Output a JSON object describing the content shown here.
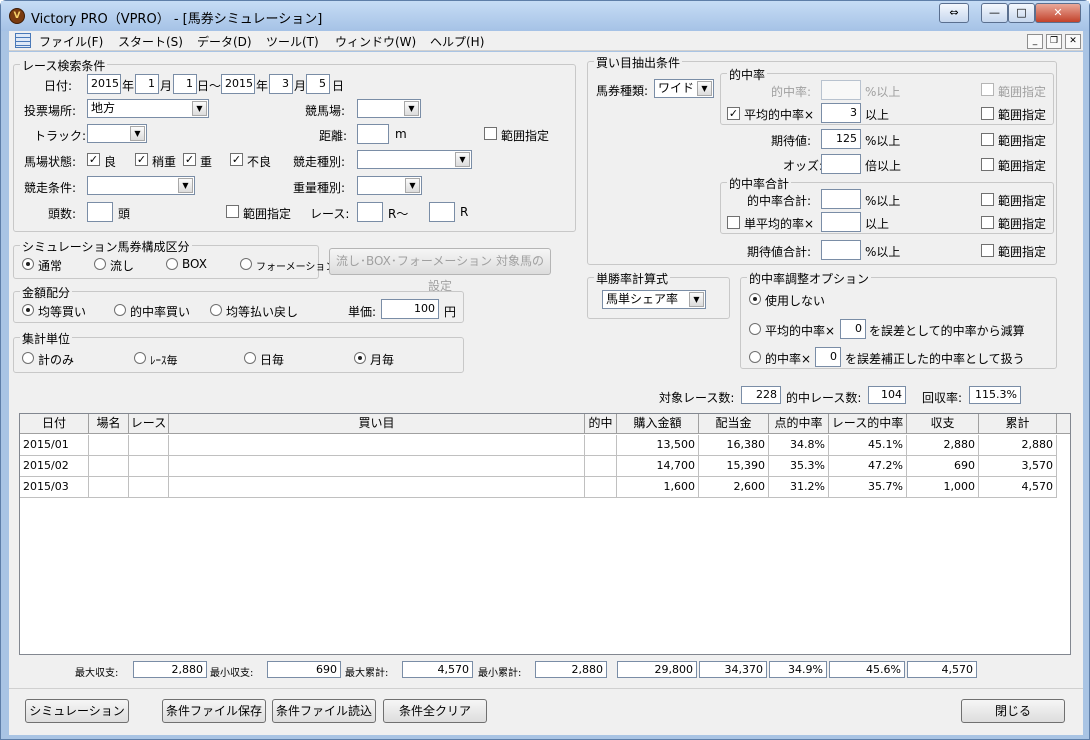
{
  "app": {
    "title": "Victory PRO（VPRO） - [馬券シミュレーション]",
    "icon": "victory-logo-icon"
  },
  "caption_buttons": {
    "back": "⇔",
    "minimize": "—",
    "maximize": "□",
    "close": "✕"
  },
  "menu": [
    "ファイル(F)",
    "スタート(S)",
    "データ(D)",
    "ツール(T)",
    "ウィンドウ(W)",
    "ヘルプ(H)"
  ],
  "mdi_buttons": {
    "minimize": "_",
    "restore": "❐",
    "close": "✕"
  },
  "race_search": {
    "legend": "レース検索条件",
    "date_label": "日付:",
    "from": {
      "year": "2015",
      "month": "1",
      "day": "1"
    },
    "to": {
      "year": "2015",
      "month": "3",
      "day": "5"
    },
    "u_year": "年",
    "u_month": "月",
    "u_day_from": "日～",
    "u_day": "日",
    "venue_place_label": "投票場所:",
    "venue_place_value": "地方",
    "track_label": "競馬場:",
    "track_value": "",
    "track_type_label": "トラック:",
    "track_type_value": "",
    "distance_label": "距離:",
    "distance_value": "",
    "distance_unit": "m",
    "range_label": "範囲指定",
    "condition_label": "馬場状態:",
    "conditions": [
      {
        "label": "良",
        "checked": true
      },
      {
        "label": "稍重",
        "checked": true
      },
      {
        "label": "重",
        "checked": true
      },
      {
        "label": "不良",
        "checked": true
      }
    ],
    "race_type_label": "競走種別:",
    "race_type_value": "",
    "race_cond_label": "競走条件:",
    "race_cond_value": "",
    "weight_label": "重量種別:",
    "weight_value": "",
    "heads_label": "頭数:",
    "heads_value": "",
    "heads_unit": "頭",
    "heads_range_label": "範囲指定",
    "race_label": "レース:",
    "race_from": "",
    "race_mid": "R～",
    "race_to": "",
    "race_unit": "R"
  },
  "sim_type": {
    "legend": "シミュレーション馬券構成区分",
    "options": [
      "通常",
      "流し",
      "BOX",
      "フォーメーション"
    ],
    "selected": 0,
    "setting_button": "流し･BOX･フォーメーション 対象馬の設定"
  },
  "amount": {
    "legend": "金額配分",
    "options": [
      "均等買い",
      "的中率買い",
      "均等払い戻し"
    ],
    "selected": 0,
    "unit_label": "単価:",
    "unit_value": "100",
    "unit": "円"
  },
  "aggregate": {
    "legend": "集計単位",
    "options": [
      "計のみ",
      "ﾚｰｽ毎",
      "日毎",
      "月毎"
    ],
    "selected": 3
  },
  "extract": {
    "legend": "買い目抽出条件",
    "ticket_label": "馬券種類:",
    "ticket_value": "ワイド",
    "hit_group": "的中率",
    "hit_rate_label": "的中率:",
    "hit_rate_value": "",
    "hit_rate_unit": "%以上",
    "avg_hit_label": "平均的中率×",
    "avg_hit_value": "3",
    "avg_hit_unit": "以上",
    "exp_label": "期待値:",
    "exp_value": "125",
    "exp_unit": "%以上",
    "odds_label": "オッズ:",
    "odds_value": "",
    "odds_unit": "倍以上",
    "total_group": "的中率合計",
    "total_hit_label": "的中率合計:",
    "total_hit_value": "",
    "total_hit_unit": "%以上",
    "single_avg_label": "単平均的率×",
    "single_avg_value": "",
    "single_avg_unit": "以上",
    "exp_total_label": "期待値合計:",
    "exp_total_value": "",
    "exp_total_unit": "%以上",
    "range_label": "範囲指定"
  },
  "win_calc": {
    "legend": "単勝率計算式",
    "value": "馬単シェア率"
  },
  "adjust": {
    "legend": "的中率調整オプション",
    "opt0": "使用しない",
    "opt1_pre": "平均的中率×",
    "opt1_val": "0",
    "opt1_post": "を誤差として的中率から減算",
    "opt2_pre": "的中率×",
    "opt2_val": "0",
    "opt2_post": "を誤差補正した的中率として扱う",
    "selected": 0
  },
  "stats": {
    "target_label": "対象レース数:",
    "target": "228",
    "hit_label": "的中レース数:",
    "hit": "104",
    "recovery_label": "回収率:",
    "recovery": "115.3%"
  },
  "table": {
    "headers": [
      "日付",
      "場名",
      "レース",
      "買い目",
      "的中",
      "購入金額",
      "配当金",
      "点的中率",
      "レース的中率",
      "収支",
      "累計"
    ],
    "rows": [
      [
        "2015/01",
        "",
        "",
        "",
        "",
        "13,500",
        "16,380",
        "34.8%",
        "45.1%",
        "2,880",
        "2,880"
      ],
      [
        "2015/02",
        "",
        "",
        "",
        "",
        "14,700",
        "15,390",
        "35.3%",
        "47.2%",
        "690",
        "3,570"
      ],
      [
        "2015/03",
        "",
        "",
        "",
        "",
        "1,600",
        "2,600",
        "31.2%",
        "35.7%",
        "1,000",
        "4,570"
      ]
    ]
  },
  "summary": {
    "max_income_label": "最大収支:",
    "max_income": "2,880",
    "min_income_label": "最小収支:",
    "min_income": "690",
    "max_cum_label": "最大累計:",
    "max_cum": "4,570",
    "min_cum_label": "最小累計:",
    "min_cum": "2,880",
    "total_buy": "29,800",
    "total_pay": "34,370",
    "point_rate": "34.9%",
    "race_rate": "45.6%",
    "total": "4,570"
  },
  "buttons": {
    "simulate": "シミュレーション",
    "save": "条件ファイル保存",
    "load": "条件ファイル読込",
    "clear": "条件全クリア",
    "close": "閉じる"
  }
}
